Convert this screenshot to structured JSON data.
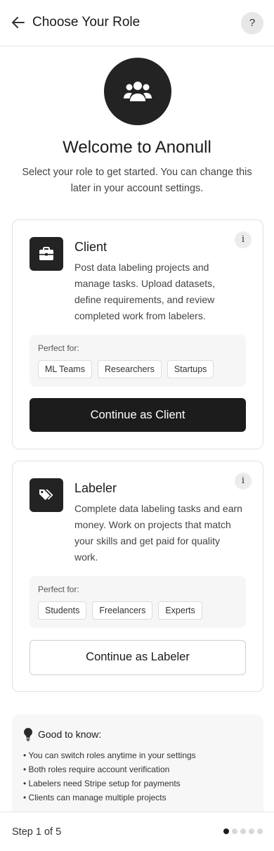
{
  "header": {
    "title": "Choose Your Role",
    "back_icon": "arrow-left-icon",
    "help_label": "?"
  },
  "intro": {
    "icon": "users-icon",
    "welcome": "Welcome to Anonull",
    "subtitle": "Select your role to get started. You can change this later in your account settings."
  },
  "roles": [
    {
      "icon": "briefcase-icon",
      "info_label": "i",
      "title": "Client",
      "description": "Post data labeling projects and manage tasks. Upload datasets, define requirements, and review completed work from labelers.",
      "perfect_for_label": "Perfect for:",
      "tags": [
        "ML Teams",
        "Researchers",
        "Startups"
      ],
      "button_label": "Continue as Client"
    },
    {
      "icon": "tags-icon",
      "info_label": "i",
      "title": "Labeler",
      "description": "Complete data labeling tasks and earn money. Work on projects that match your skills and get paid for quality work.",
      "perfect_for_label": "Perfect for:",
      "tags": [
        "Students",
        "Freelancers",
        "Experts"
      ],
      "button_label": "Continue as Labeler"
    }
  ],
  "good_to_know": {
    "icon": "lightbulb-icon",
    "title": "Good to know:",
    "items": [
      "• You can switch roles anytime in your settings",
      "• Both roles require account verification",
      "• Labelers need Stripe setup for payments",
      "• Clients can manage multiple projects"
    ]
  },
  "footer": {
    "step_label": "Step 1 of 5",
    "current_step": 1,
    "total_steps": 5
  },
  "colors": {
    "primary": "#1c1c1c",
    "muted_bg": "#f6f6f6",
    "border": "#e2e2e2"
  }
}
